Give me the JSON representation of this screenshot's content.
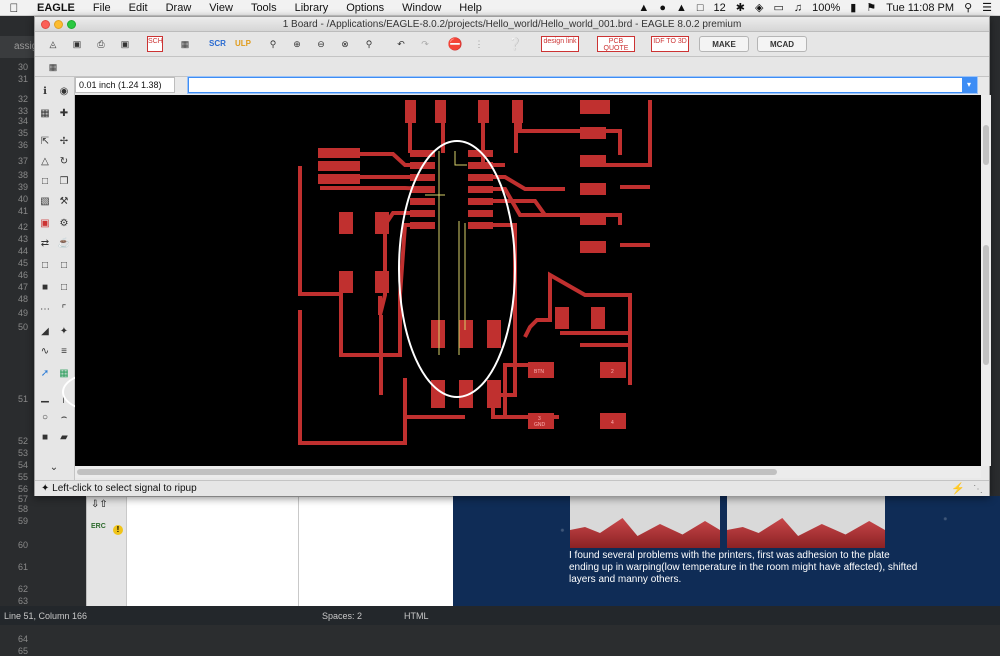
{
  "menubar": {
    "app_name": "EAGLE",
    "items": [
      "File",
      "Edit",
      "Draw",
      "View",
      "Tools",
      "Library",
      "Options",
      "Window",
      "Help"
    ],
    "status_right": {
      "battery": "100%",
      "time": "Tue 11:08 PM",
      "notification_count": "12"
    }
  },
  "editor": {
    "tab_label": "assig",
    "line_numbers": [
      "30",
      "31",
      "32",
      "33",
      "34",
      "35",
      "36",
      "37",
      "38",
      "39",
      "40",
      "41",
      "42",
      "43",
      "44",
      "45",
      "46",
      "47",
      "48",
      "49",
      "50",
      "51",
      "52",
      "53",
      "54",
      "55",
      "56",
      "57",
      "58",
      "59",
      "60",
      "61",
      "62",
      "63",
      "64",
      "65"
    ],
    "status": {
      "position": "Line 51, Column 166",
      "spaces": "Spaces: 2",
      "syntax": "HTML"
    }
  },
  "eagle": {
    "title": "1 Board - /Applications/EAGLE-8.0.2/projects/Hello_world/Hello_world_001.brd - EAGLE 8.0.2 premium",
    "toolbar": {
      "design_link": "design link",
      "pcb_quote": "PCB QUOTE",
      "idf_3d": "IDF TO 3D",
      "make": "MAKE",
      "mcad": "MCAD"
    },
    "coordinates": "0.01 inch (1.24 1.38)",
    "command_value": "",
    "status_message": "Left-click to select signal to ripup",
    "pads": {
      "btn": "BTN",
      "two": "2",
      "three": "3",
      "gnd": "GND",
      "four": "4"
    }
  },
  "lower_left": {
    "erc": "ERC",
    "warning": "!"
  },
  "preview": {
    "caption": "I found several problems with the printers, first was adhesion to the plate ending up in warping(low temperature in the room might have affected), shifted layers and manny others."
  },
  "colors": {
    "trace": "#c0302f",
    "canvas": "#000000",
    "airwire": "#d9d16a",
    "highlight": "#ffffff"
  }
}
